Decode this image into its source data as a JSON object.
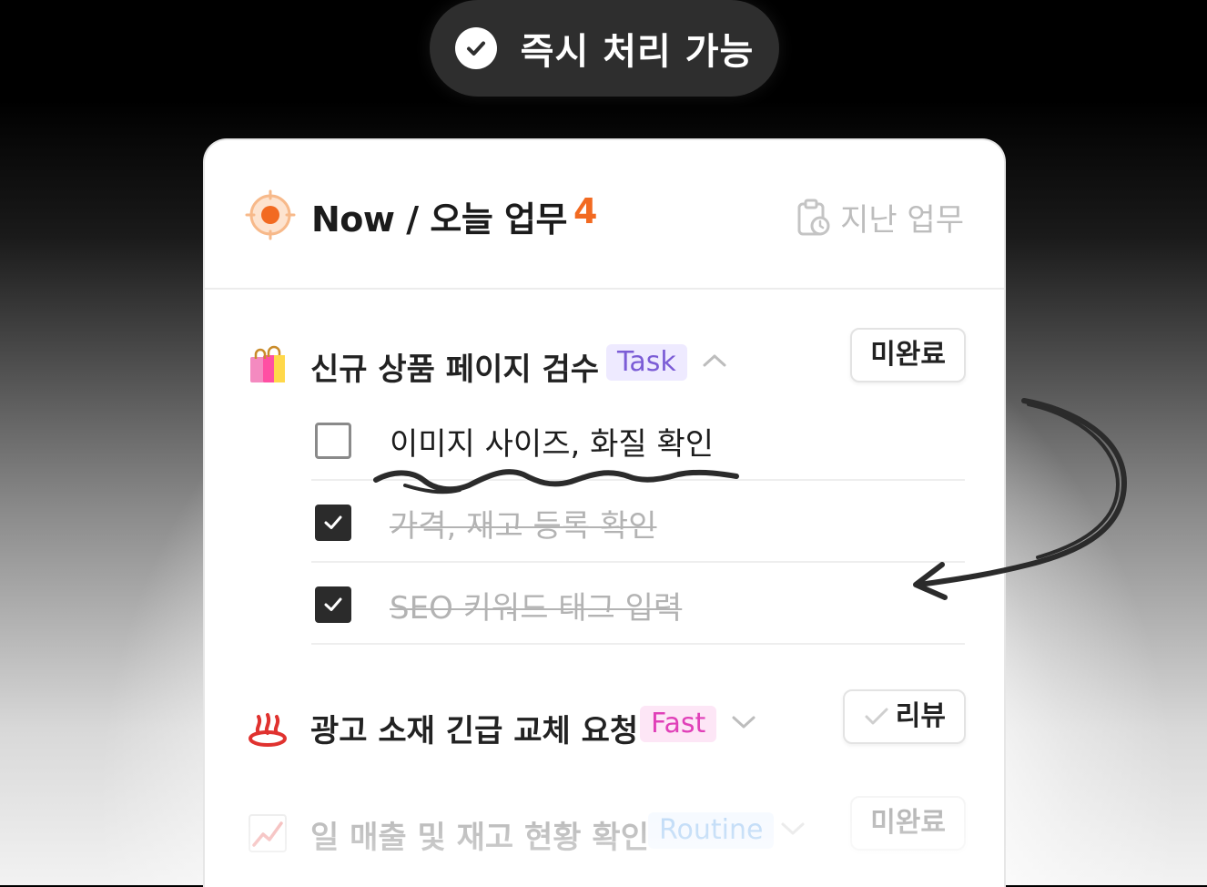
{
  "badge": {
    "label": "즉시 처리 가능",
    "icon": "check-circle-icon"
  },
  "header": {
    "title": "Now / 오늘 업무",
    "count": "4",
    "history_label": "지난 업무",
    "accent_color": "#f26a21"
  },
  "groups": [
    {
      "emoji": "shopping-bags-icon",
      "title": "신규 상품 페이지 검수",
      "tag": "Task",
      "tag_color": "#7b5cd6",
      "expanded": true,
      "status": "미완료",
      "subtasks": [
        {
          "label": "이미지 사이즈, 화질 확인",
          "done": false
        },
        {
          "label": "가격, 재고 등록 확인",
          "done": true
        },
        {
          "label": "SEO 키워드 태그 입력",
          "done": true
        }
      ]
    },
    {
      "emoji": "hot-springs-icon",
      "title": "광고 소재 긴급 교체 요청",
      "tag": "Fast",
      "tag_color": "#e040b8",
      "expanded": false,
      "status": "리뷰"
    },
    {
      "emoji": "chart-increasing-icon",
      "title": "일 매출 및 재고 현황 확인",
      "tag": "Routine",
      "tag_color": "#3a8ee6",
      "expanded": false,
      "status": "미완료"
    }
  ]
}
